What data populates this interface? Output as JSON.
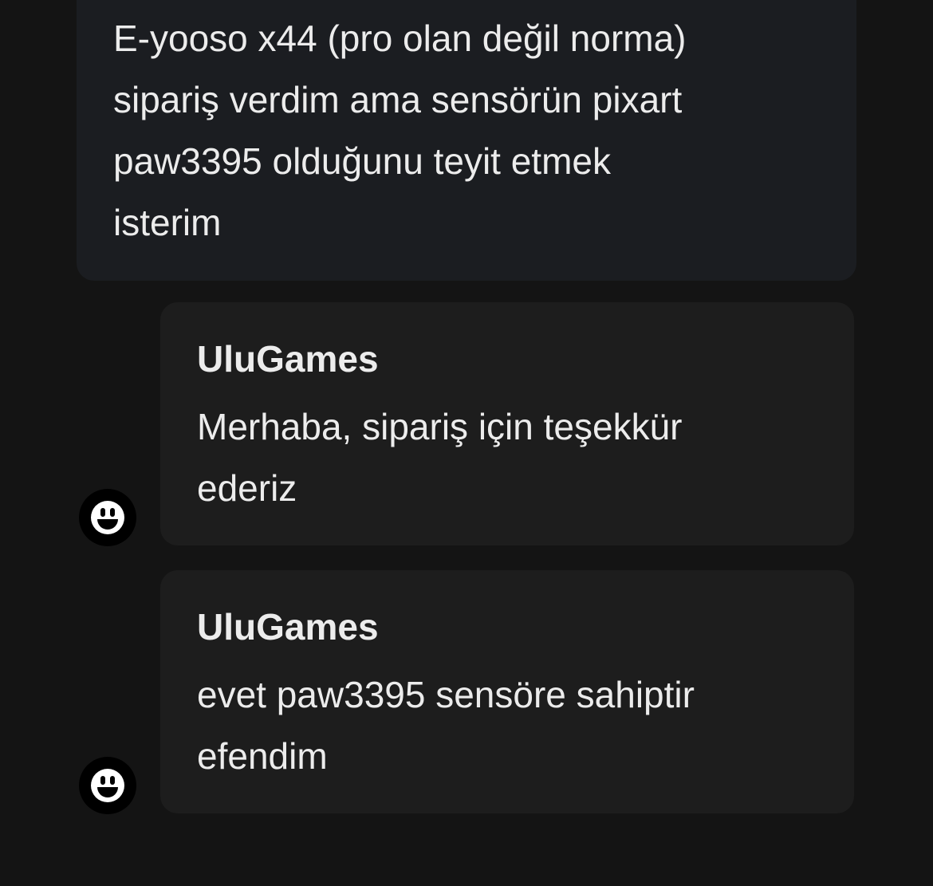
{
  "conversation": {
    "customer_message": {
      "text": "E-yooso x44 (pro olan değil norma)\nsipariş verdim ama sensörün pixart\npaw3395 olduğunu teyit etmek\nisterim"
    },
    "replies": [
      {
        "sender": "UluGames",
        "text": "Merhaba, sipariş için teşekkür\nederiz",
        "avatar_icon": "smiley-face-icon"
      },
      {
        "sender": "UluGames",
        "text": "evet paw3395 sensöre sahiptir\nefendim",
        "avatar_icon": "smiley-face-icon"
      }
    ]
  },
  "colors": {
    "background": "#141414",
    "customer_bubble": "#1b1d21",
    "reply_bubble": "#1d1d1d",
    "text": "#ececec",
    "avatar_bg": "#000000"
  }
}
